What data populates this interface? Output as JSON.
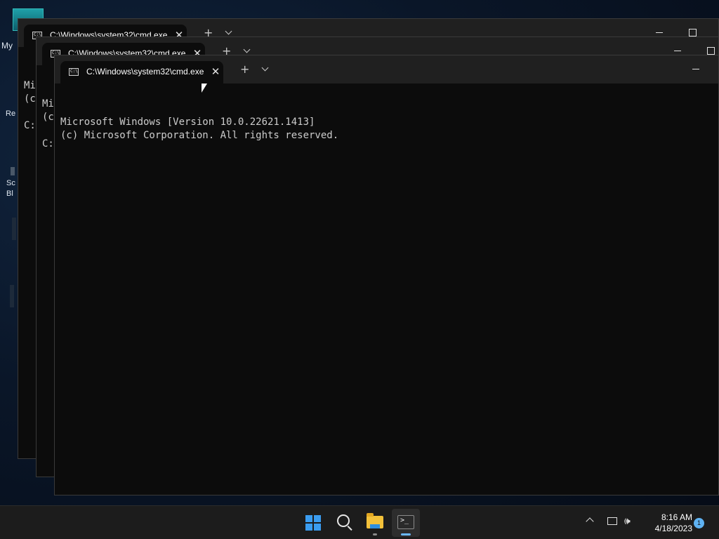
{
  "desktop": {
    "label_my": "My",
    "label_re": "Re",
    "label_sc": "Sc",
    "label_bl": "Bl"
  },
  "windows": [
    {
      "tab_title": "C:\\Windows\\system32\\cmd.exe",
      "console_lines": [
        "Mi",
        "(c",
        "",
        "C:"
      ]
    },
    {
      "tab_title": "C:\\Windows\\system32\\cmd.exe",
      "console_lines": [
        "Mi",
        "(c",
        "",
        "C:"
      ]
    },
    {
      "tab_title": "C:\\Windows\\system32\\cmd.exe",
      "console_lines": [
        "Microsoft Windows [Version 10.0.22621.1413]",
        "(c) Microsoft Corporation. All rights reserved."
      ]
    }
  ],
  "titlebar": {
    "new_tab": "+",
    "close_tab": "✕"
  },
  "taskbar": {
    "apps": [
      {
        "name": "Start",
        "icon": "windows-logo-icon"
      },
      {
        "name": "Search",
        "icon": "search-icon"
      },
      {
        "name": "File Explorer",
        "icon": "folder-icon"
      },
      {
        "name": "Terminal",
        "icon": "terminal-icon"
      }
    ],
    "clock_time": "8:16 AM",
    "clock_date": "4/18/2023",
    "notification_count": "1",
    "colors": {
      "accent": "#3a9cf0",
      "indicator": "#6ab8ff",
      "taskbar_bg": "#1c1c1c"
    }
  }
}
